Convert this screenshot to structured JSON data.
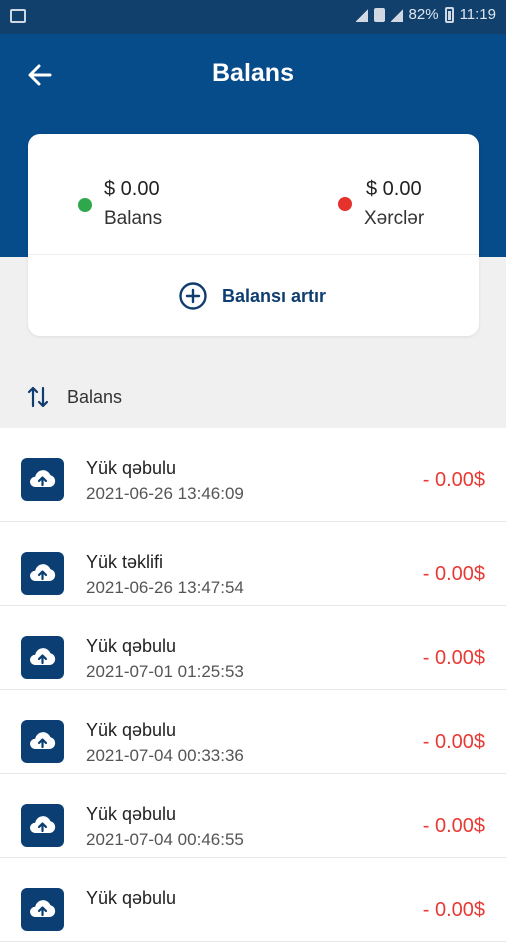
{
  "statusbar": {
    "battery": "82%",
    "time": "11:19"
  },
  "header": {
    "title": "Balans"
  },
  "summary": {
    "balance": {
      "amount": "$ 0.00",
      "label": "Balans"
    },
    "expenses": {
      "amount": "$ 0.00",
      "label": "Xərclər"
    },
    "add_balance_label": "Balansı artır"
  },
  "sort": {
    "label": "Balans"
  },
  "transactions": [
    {
      "title": "Yük qəbulu",
      "date": "2021-06-26 13:46:09",
      "amount": "- 0.00$"
    },
    {
      "title": "Yük təklifi",
      "date": "2021-06-26 13:47:54",
      "amount": "- 0.00$"
    },
    {
      "title": "Yük qəbulu",
      "date": "2021-07-01 01:25:53",
      "amount": "- 0.00$"
    },
    {
      "title": "Yük qəbulu",
      "date": "2021-07-04 00:33:36",
      "amount": "- 0.00$"
    },
    {
      "title": "Yük qəbulu",
      "date": "2021-07-04 00:46:55",
      "amount": "- 0.00$"
    },
    {
      "title": "Yük qəbulu",
      "date": "",
      "amount": "- 0.00$"
    }
  ],
  "colors": {
    "primary": "#064b8a",
    "negative": "#e83a34",
    "positive_dot": "#2ea84b",
    "negative_dot": "#e5322c"
  }
}
